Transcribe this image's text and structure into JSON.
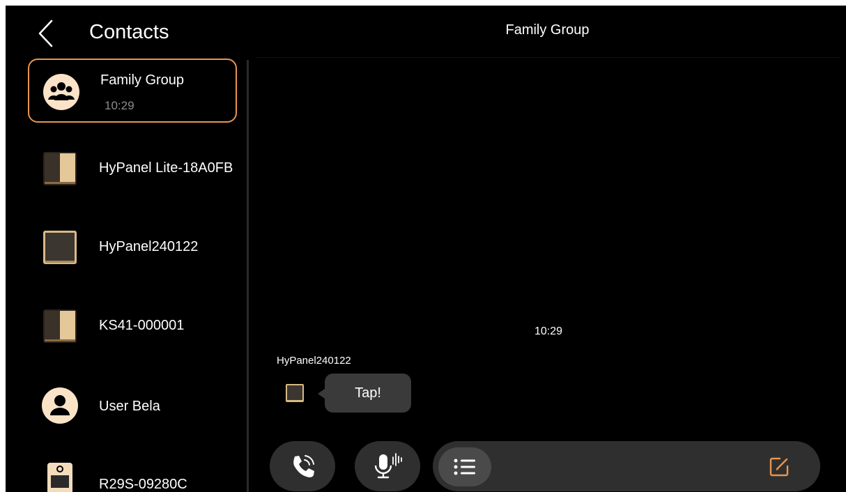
{
  "sidebar": {
    "back_icon": "chevron-left-icon",
    "title": "Contacts",
    "contacts": [
      {
        "name": "Family Group",
        "time": "10:29",
        "icon": "group-icon"
      },
      {
        "name": "HyPanel Lite-18A0FB",
        "icon": "panel-device-icon"
      },
      {
        "name": "HyPanel240122",
        "icon": "panel-device-icon"
      },
      {
        "name": "KS41-000001",
        "icon": "panel-device-icon"
      },
      {
        "name": "User Bela",
        "icon": "user-icon"
      },
      {
        "name": "R29S-09280C",
        "icon": "door-station-icon"
      }
    ]
  },
  "chat": {
    "title": "Family Group",
    "messages": [
      {
        "time": "10:29",
        "sender": "HyPanel240122",
        "text": "Tap!"
      }
    ]
  },
  "controls": {
    "call_icon": "phone-call-icon",
    "voice_icon": "microphone-icon",
    "list_icon": "list-icon",
    "edit_icon": "edit-icon"
  },
  "colors": {
    "accent": "#e8954f",
    "background": "#000000",
    "control_bg": "#2f2f2f",
    "avatar_cream": "#fbe3c7"
  }
}
